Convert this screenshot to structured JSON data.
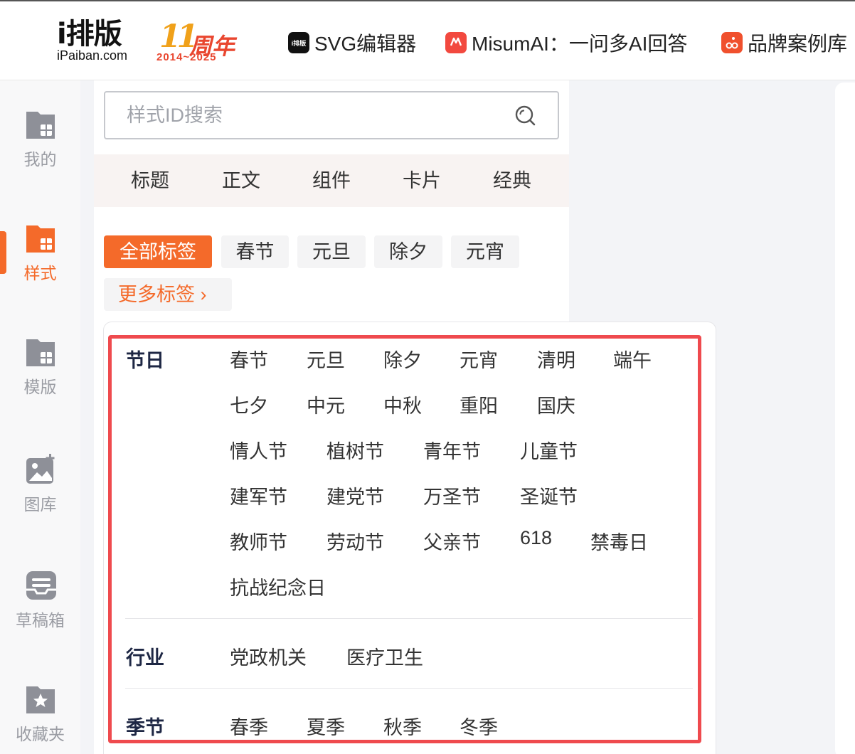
{
  "brand": {
    "logo_main": "i排版",
    "logo_sub": "iPaiban.com",
    "anniv_num": "11",
    "anniv_text": "周年",
    "anniv_years": "2014~2025"
  },
  "top_links": [
    {
      "label": "SVG编辑器",
      "icon": "svg-editor-icon",
      "icon_text": "i排版",
      "color": "#111111"
    },
    {
      "label": "MisumAI：一问多AI回答",
      "icon": "misumai-icon",
      "icon_text": "",
      "color": "#f2493f"
    },
    {
      "label": "品牌案例库",
      "icon": "brand-case-icon",
      "icon_text": "",
      "color": "#f0502d"
    }
  ],
  "nav": [
    {
      "label": "我的",
      "icon": "folder-icon"
    },
    {
      "label": "样式",
      "icon": "style-folder-icon",
      "active": true
    },
    {
      "label": "模版",
      "icon": "template-folder-icon"
    },
    {
      "label": "图库",
      "icon": "image-add-icon"
    },
    {
      "label": "草稿箱",
      "icon": "draft-box-icon"
    },
    {
      "label": "收藏夹",
      "icon": "favorite-folder-icon"
    }
  ],
  "search": {
    "placeholder": "样式ID搜索"
  },
  "tabs": [
    "标题",
    "正文",
    "组件",
    "卡片",
    "经典"
  ],
  "chips": [
    "全部标签",
    "春节",
    "元旦",
    "除夕",
    "元宵"
  ],
  "more_tags": "更多标签 ›",
  "categories": [
    {
      "title": "节日",
      "rows": [
        [
          "春节",
          "元旦",
          "除夕",
          "元宵",
          "清明",
          "端午"
        ],
        [
          "七夕",
          "中元",
          "中秋",
          "重阳",
          "国庆"
        ],
        [
          "情人节",
          "植树节",
          "青年节",
          "儿童节"
        ],
        [
          "建军节",
          "建党节",
          "万圣节",
          "圣诞节"
        ],
        [
          "教师节",
          "劳动节",
          "父亲节",
          "618",
          "禁毒日"
        ],
        [
          "抗战纪念日"
        ]
      ]
    },
    {
      "title": "行业",
      "rows": [
        [
          "党政机关",
          "医疗卫生"
        ]
      ]
    },
    {
      "title": "季节",
      "rows": [
        [
          "春季",
          "夏季",
          "秋季",
          "冬季"
        ]
      ]
    }
  ],
  "colors": {
    "accent": "#f46a2a",
    "highlight": "#ef4a4e",
    "nav_inactive": "#9a9ca3"
  }
}
